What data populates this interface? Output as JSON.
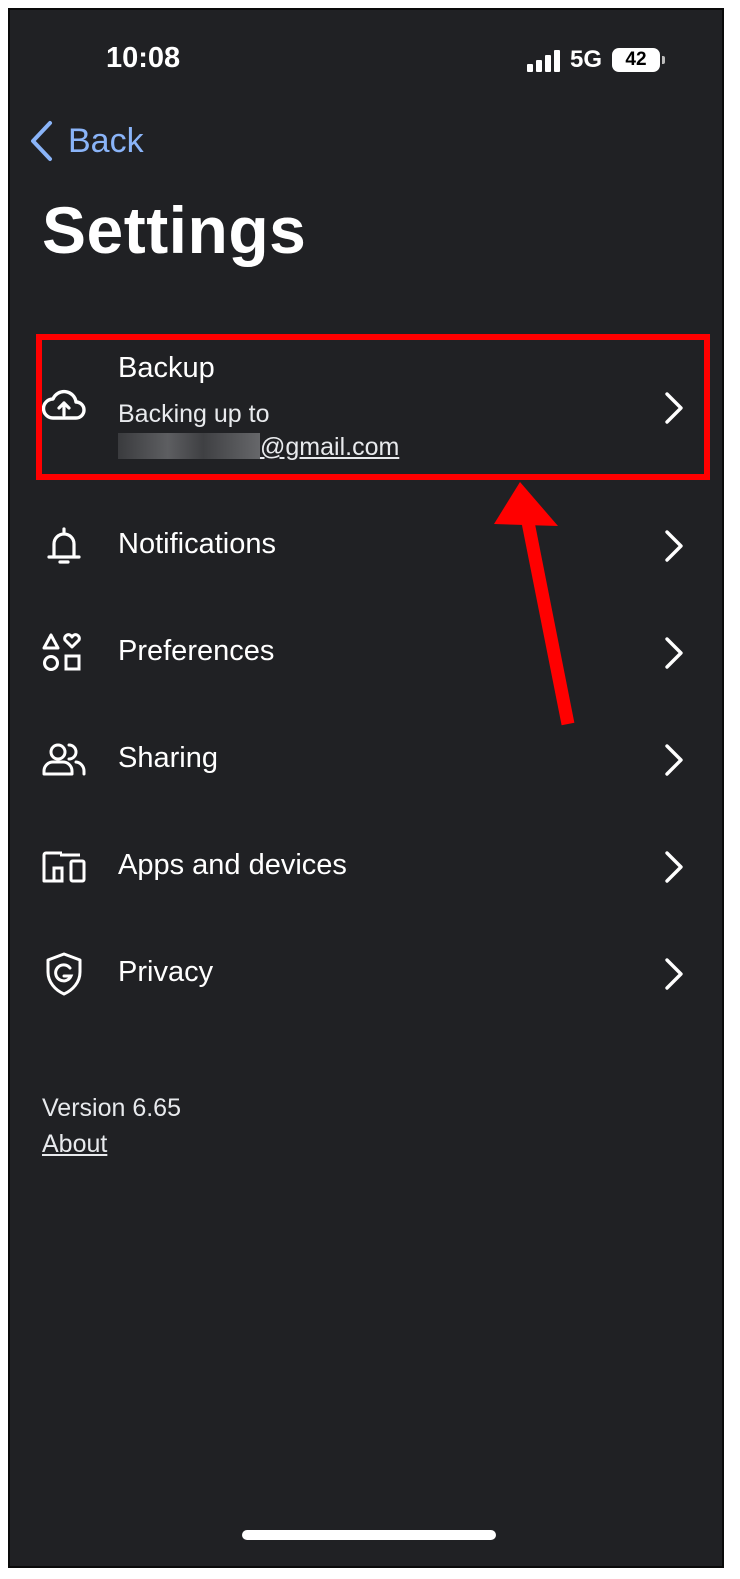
{
  "status_bar": {
    "time": "10:08",
    "network": "5G",
    "battery": "42"
  },
  "nav": {
    "back_label": "Back"
  },
  "page": {
    "title": "Settings"
  },
  "backup": {
    "label": "Backing up to",
    "title": "Backup",
    "email_visible": "@gmail.com"
  },
  "menu": {
    "items": [
      {
        "label": "Notifications",
        "icon": "bell-icon"
      },
      {
        "label": "Preferences",
        "icon": "shapes-icon"
      },
      {
        "label": "Sharing",
        "icon": "people-icon"
      },
      {
        "label": "Apps and devices",
        "icon": "devices-icon"
      },
      {
        "label": "Privacy",
        "icon": "google-shield-icon"
      }
    ]
  },
  "footer": {
    "version": "Version 6.65",
    "about": "About"
  },
  "colors": {
    "background": "#202124",
    "accent": "#8ab4f8",
    "highlight": "#ff0000"
  }
}
